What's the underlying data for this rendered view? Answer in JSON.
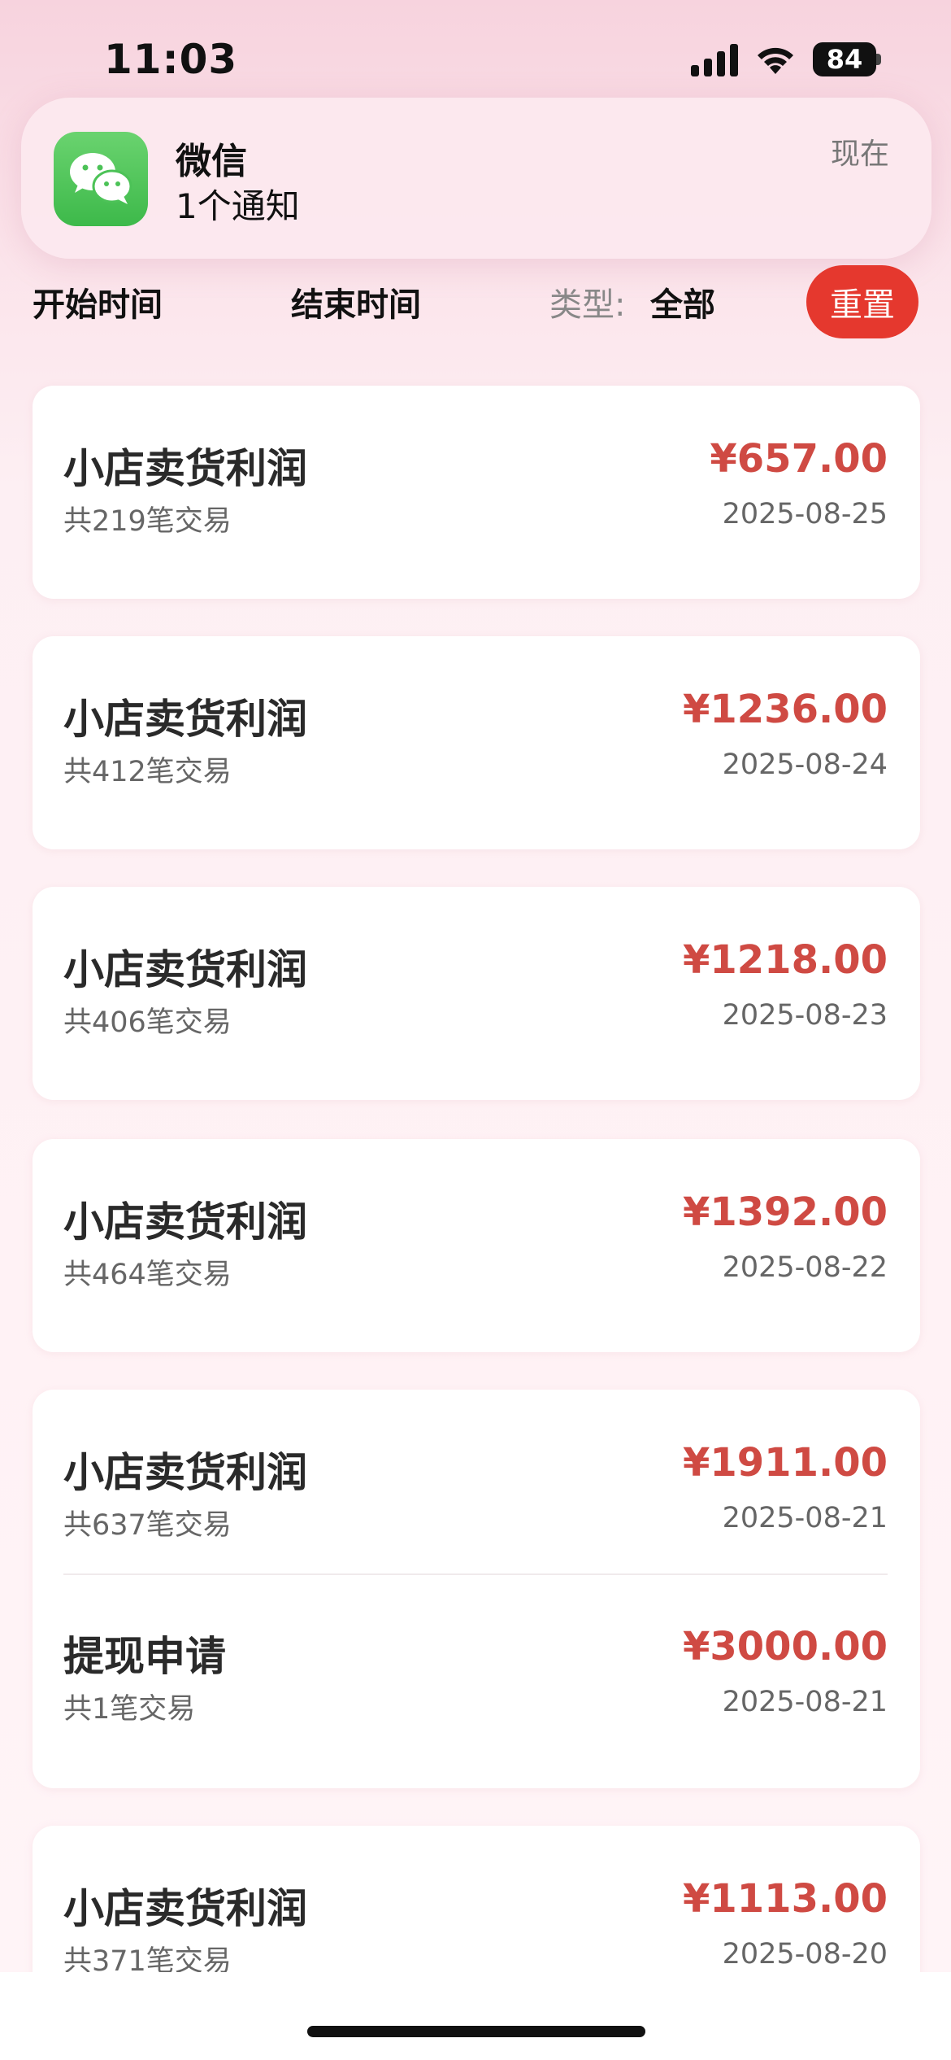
{
  "status_bar": {
    "time": "11:03",
    "battery_level": "84"
  },
  "notification": {
    "app_icon": "wechat-icon",
    "app_name": "微信",
    "message": "1个通知",
    "time": "现在"
  },
  "filters": {
    "start_time_label": "开始时间",
    "end_time_label": "结束时间",
    "type_label": "类型:",
    "type_value": "全部",
    "reset_label": "重置"
  },
  "records": [
    {
      "title": "小店卖货利润",
      "count": "共219笔交易",
      "amount": "¥657.00",
      "date": "2025-08-25"
    },
    {
      "title": "小店卖货利润",
      "count": "共412笔交易",
      "amount": "¥1236.00",
      "date": "2025-08-24"
    },
    {
      "title": "小店卖货利润",
      "count": "共406笔交易",
      "amount": "¥1218.00",
      "date": "2025-08-23"
    },
    {
      "title": "小店卖货利润",
      "count": "共464笔交易",
      "amount": "¥1392.00",
      "date": "2025-08-22"
    },
    {
      "title": "小店卖货利润",
      "count": "共637笔交易",
      "amount": "¥1911.00",
      "date": "2025-08-21"
    },
    {
      "title": "提现申请",
      "count": "共1笔交易",
      "amount": "¥3000.00",
      "date": "2025-08-21"
    },
    {
      "title": "小店卖货利润",
      "count": "共371笔交易",
      "amount": "¥1113.00",
      "date": "2025-08-20"
    }
  ],
  "colors": {
    "amount": "#cf4a43",
    "reset_button": "#e5382e",
    "wechat_green": "#4cc257"
  }
}
